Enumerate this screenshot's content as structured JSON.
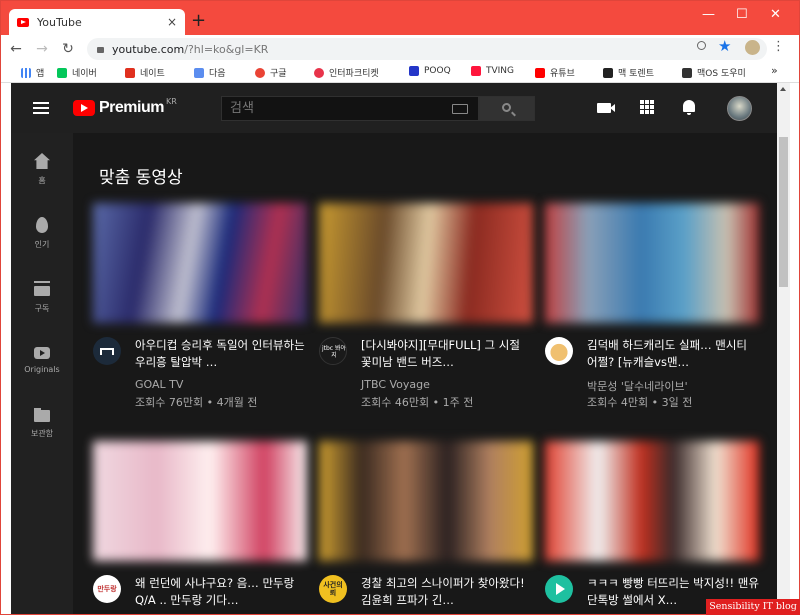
{
  "browser": {
    "tab_title": "YouTube",
    "tab_close": "×",
    "new_tab": "+",
    "window_controls": {
      "minimize": "—",
      "maximize": "☐",
      "close": "✕"
    },
    "url_host": "youtube.com",
    "url_path": "/?hl=ko&gl=KR",
    "nav": {
      "back": "←",
      "forward": "→",
      "reload": "↻"
    },
    "bookmarks": [
      {
        "label": "앱",
        "color": "#4285f4"
      },
      {
        "label": "네이버",
        "color": "#03c75a"
      },
      {
        "label": "네이트",
        "color": "#e0301e"
      },
      {
        "label": "다음",
        "color": "#5b8def"
      },
      {
        "label": "구글",
        "color": "#ea4335"
      },
      {
        "label": "인터파크티켓",
        "color": "#e8334a"
      },
      {
        "label": "POOQ",
        "color": "#2436c8"
      },
      {
        "label": "TVING",
        "color": "#ff153c"
      },
      {
        "label": "유튜브",
        "color": "#ff0000"
      },
      {
        "label": "맥 토렌트",
        "color": "#222222"
      },
      {
        "label": "맥OS 도우미",
        "color": "#333333"
      }
    ],
    "bookmarks_more": "»"
  },
  "masthead": {
    "logo_text": "Premium",
    "logo_region": "KR",
    "search_placeholder": "검색"
  },
  "guide": [
    {
      "label": "홈",
      "icon": "home-icon"
    },
    {
      "label": "인기",
      "icon": "fire-icon"
    },
    {
      "label": "구독",
      "icon": "subscriptions-icon"
    },
    {
      "label": "Originals",
      "icon": "originals-icon"
    },
    {
      "label": "보관함",
      "icon": "library-icon"
    }
  ],
  "main": {
    "section_title": "맞춤 동영상",
    "videos": [
      {
        "title": "아우디컵 승리후 독일어 인터뷰하는 우리흥 탈압박 …",
        "channel": "GOAL TV",
        "stats": "조회수 76만회 • 4개월 전",
        "avatar_text": ""
      },
      {
        "title": "[다시봐야지][무대FULL] 그 시절 꽃미남 밴드 버즈…",
        "channel": "JTBC Voyage",
        "stats": "조회수 46만회 • 1주 전",
        "avatar_text": "jtbc 봐야지"
      },
      {
        "title": "김덕배 하드캐리도 실패… 맨시티 어쩔? [뉴캐슬vs맨…",
        "channel": "박문성 '달수네라이브'",
        "stats": "조회수 4만회 • 3일 전",
        "avatar_text": ""
      },
      {
        "title": "왜 런던에 사냐구요? 음… 만두랑 Q/A .. 만두랑 기다…",
        "channel": "",
        "stats": "",
        "avatar_text": "만두랑"
      },
      {
        "title": "경찰 최고의 스나이퍼가 찾아왔다! 김윤희 프파가 긴…",
        "channel": "",
        "stats": "",
        "avatar_text": "사건의뢰"
      },
      {
        "title": "ㅋㅋㅋ 빵빵 터뜨리는 박지성!! 맨유 단톡방 썰에서 X…",
        "channel": "",
        "stats": "",
        "avatar_text": ""
      }
    ]
  },
  "watermark": "Sensibility IT blog"
}
